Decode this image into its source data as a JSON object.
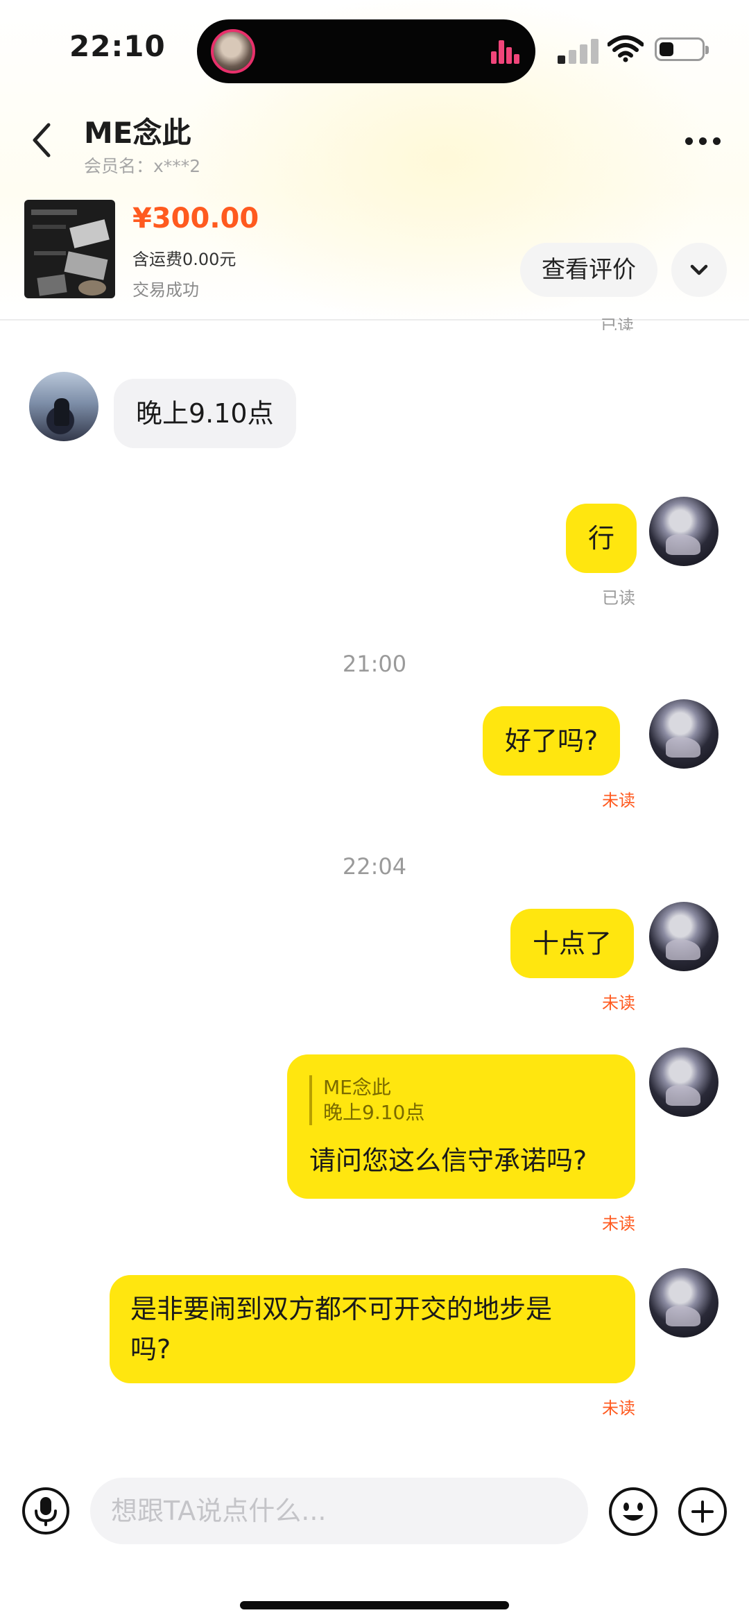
{
  "status_bar": {
    "time": "22:10"
  },
  "header": {
    "peer_name": "ME念此",
    "member_label": "会员名：x***2"
  },
  "product": {
    "price": "¥300.00",
    "shipping": "含运费0.00元",
    "status": "交易成功",
    "review_button": "查看评价"
  },
  "messages": {
    "partial_read": "已读",
    "m1": {
      "text": "晚上9.10点"
    },
    "m2": {
      "text": "行",
      "receipt": "已读"
    },
    "ts1": "21:00",
    "m3": {
      "text": "好了吗?",
      "receipt": "未读"
    },
    "ts2": "22:04",
    "m4": {
      "text": "十点了",
      "receipt": "未读"
    },
    "m5": {
      "quote_name": "ME念此",
      "quote_text": "晚上9.10点",
      "text": "请问您这么信守承诺吗?",
      "receipt": "未读"
    },
    "m6": {
      "line1": "是非要闹到双方都不可开交的地步是",
      "line2": "吗?",
      "receipt": "未读"
    }
  },
  "input_bar": {
    "placeholder": "想跟TA说点什么..."
  },
  "colors": {
    "accent_yellow": "#ffe60f",
    "price_orange": "#ff5a1f"
  }
}
